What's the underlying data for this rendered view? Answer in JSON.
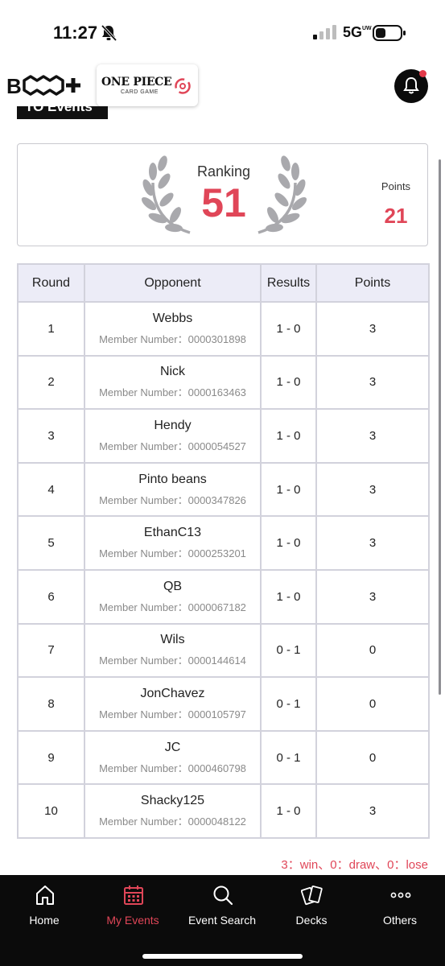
{
  "status_bar": {
    "time": "11:27",
    "network": "5G",
    "network_sub": "UW"
  },
  "header": {
    "bcg_logo_text": "B",
    "one_piece_title": "ONE PIECE",
    "one_piece_sub": "CARD GAME"
  },
  "section_title": "TO Events",
  "ranking": {
    "label": "Ranking",
    "value": "51",
    "points_label": "Points",
    "points_value": "21"
  },
  "table": {
    "headers": [
      "Round",
      "Opponent",
      "Results",
      "Points"
    ],
    "rows": [
      {
        "round": "1",
        "opponent": "Webbs",
        "member": "Member Number：0000301898",
        "result": "1 - 0",
        "points": "3"
      },
      {
        "round": "2",
        "opponent": "Nick",
        "member": "Member Number：0000163463",
        "result": "1 - 0",
        "points": "3"
      },
      {
        "round": "3",
        "opponent": "Hendy",
        "member": "Member Number：0000054527",
        "result": "1 - 0",
        "points": "3"
      },
      {
        "round": "4",
        "opponent": "Pinto beans",
        "member": "Member Number：0000347826",
        "result": "1 - 0",
        "points": "3"
      },
      {
        "round": "5",
        "opponent": "EthanC13",
        "member": "Member Number：0000253201",
        "result": "1 - 0",
        "points": "3"
      },
      {
        "round": "6",
        "opponent": "QB",
        "member": "Member Number：0000067182",
        "result": "1 - 0",
        "points": "3"
      },
      {
        "round": "7",
        "opponent": "Wils",
        "member": "Member Number：0000144614",
        "result": "0 - 1",
        "points": "0"
      },
      {
        "round": "8",
        "opponent": "JonChavez",
        "member": "Member Number：0000105797",
        "result": "0 - 1",
        "points": "0"
      },
      {
        "round": "9",
        "opponent": "JC",
        "member": "Member Number：0000460798",
        "result": "0 - 1",
        "points": "0"
      },
      {
        "round": "10",
        "opponent": "Shacky125",
        "member": "Member Number：0000048122",
        "result": "1 - 0",
        "points": "3"
      }
    ]
  },
  "legend": "3：win、0：draw、0：lose",
  "nav": {
    "home": "Home",
    "my_events": "My Events",
    "event_search": "Event Search",
    "decks": "Decks",
    "others": "Others"
  },
  "colors": {
    "accent": "#e04658",
    "nav_bg": "#0b0b0b",
    "header_row": "#ececf7"
  }
}
